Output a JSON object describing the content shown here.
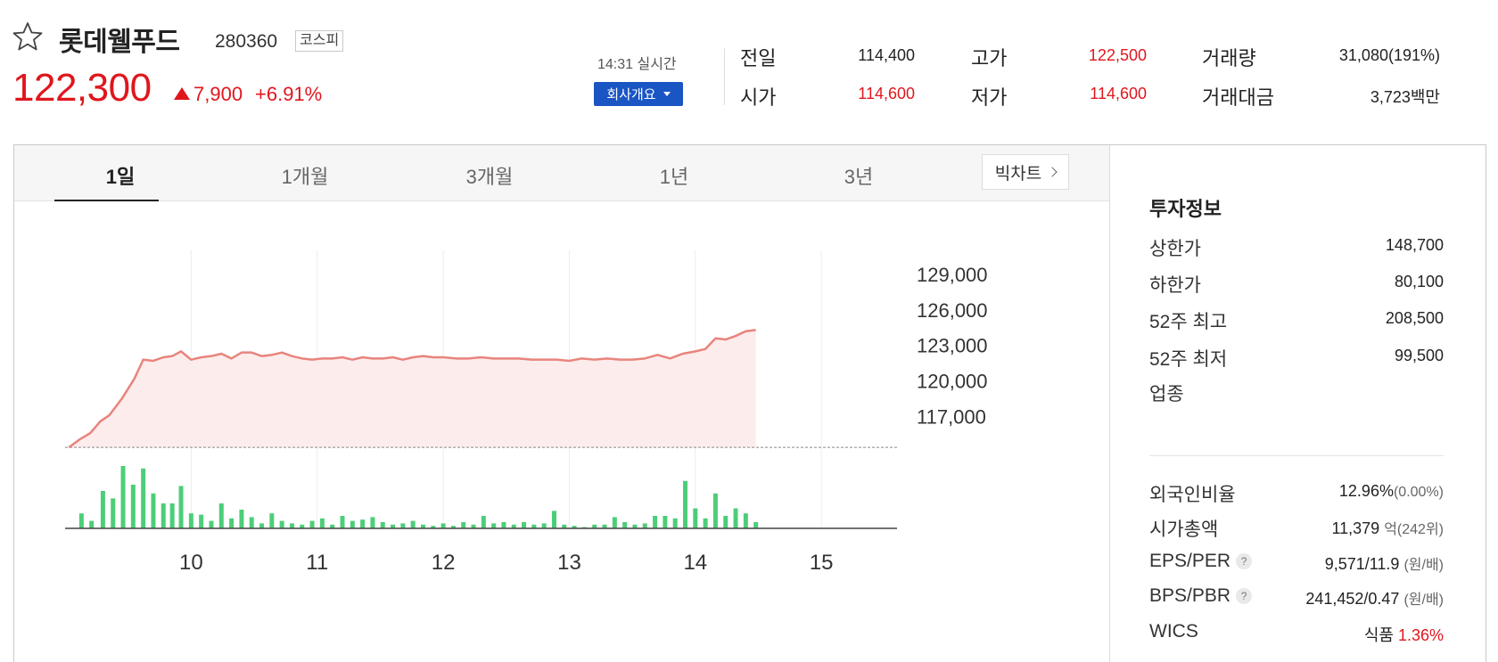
{
  "header": {
    "name": "롯데웰푸드",
    "code": "280360",
    "market": "코스피",
    "price": "122,300",
    "change": "7,900",
    "rate": "+6.91%",
    "rt_time": "14:31 실시간",
    "company_btn": "회사개요"
  },
  "stats": {
    "prev_label": "전일",
    "prev": "114,400",
    "open_label": "시가",
    "open": "114,600",
    "high_label": "고가",
    "high": "122,500",
    "low_label": "저가",
    "low": "114,600",
    "vol_label": "거래량",
    "vol": "31,080(191%)",
    "amt_label": "거래대금",
    "amt": "3,723백만"
  },
  "tabs": [
    "1일",
    "1개월",
    "3개월",
    "1년",
    "3년"
  ],
  "bigchart_label": "빅차트",
  "info": {
    "title": "투자정보",
    "upper_label": "상한가",
    "upper": "148,700",
    "lower_label": "하한가",
    "lower": "80,100",
    "w52h_label": "52주 최고",
    "w52h": "208,500",
    "w52l_label": "52주 최저",
    "w52l": "99,500",
    "sector_label": "업종",
    "foreign_label": "외국인비율",
    "foreign": "12.96%",
    "foreign_sub": "(0.00%)",
    "mcap_label": "시가총액",
    "mcap": "11,379",
    "mcap_unit": "억",
    "mcap_sub": "(242위)",
    "eps_label": "EPS/PER",
    "eps": "9,571/11.9",
    "eps_sub": "(원/배)",
    "bps_label": "BPS/PBR",
    "bps": "241,452/0.47",
    "bps_sub": "(원/배)",
    "wics_label": "WICS",
    "wics": "식품",
    "wics_rate": "1.36%"
  },
  "chart_data": {
    "type": "area",
    "y_ticks": [
      "129,000",
      "126,000",
      "123,000",
      "120,000",
      "117,000"
    ],
    "x_ticks": [
      "10",
      "11",
      "12",
      "13",
      "14",
      "15"
    ],
    "ylim": [
      112000,
      132000
    ],
    "xlim": [
      9.0,
      15.6
    ],
    "baseline": 114400,
    "colors": {
      "line": "#e8847d",
      "fill": "#fdecec",
      "volume": "#4cce78"
    },
    "series": [
      {
        "x": [
          9.03,
          9.12,
          9.2,
          9.28,
          9.35,
          9.45,
          9.55,
          9.62,
          9.7,
          9.78,
          9.85,
          9.92,
          10.0,
          10.08,
          10.16,
          10.24,
          10.32,
          10.4,
          10.48,
          10.56,
          10.64,
          10.72,
          10.8,
          10.88,
          10.96,
          11.04,
          11.12,
          11.2,
          11.28,
          11.36,
          11.44,
          11.52,
          11.6,
          11.68,
          11.76,
          11.84,
          11.92,
          12.0,
          12.1,
          12.2,
          12.3,
          12.4,
          12.5,
          12.6,
          12.7,
          12.8,
          12.9,
          13.0,
          13.1,
          13.2,
          13.3,
          13.4,
          13.5,
          13.6,
          13.7,
          13.8,
          13.9,
          14.0,
          14.08,
          14.16,
          14.24,
          14.32,
          14.4,
          14.48
        ],
        "y": [
          114400,
          115100,
          115600,
          116600,
          117100,
          118500,
          120200,
          121800,
          121700,
          122000,
          122100,
          122500,
          121800,
          122000,
          122100,
          122300,
          121900,
          122400,
          122400,
          122100,
          122200,
          122400,
          122100,
          121900,
          121800,
          121900,
          121900,
          122000,
          121800,
          122000,
          121900,
          121900,
          122000,
          121800,
          122000,
          122100,
          122000,
          122000,
          121900,
          121900,
          122000,
          121900,
          121900,
          121900,
          121800,
          121800,
          121800,
          121700,
          121900,
          121800,
          121900,
          121800,
          121800,
          121900,
          122200,
          121900,
          122300,
          122500,
          122700,
          123600,
          123500,
          123800,
          124200,
          124300
        ]
      }
    ],
    "volume": {
      "x": [
        9.13,
        9.21,
        9.3,
        9.38,
        9.46,
        9.54,
        9.62,
        9.7,
        9.78,
        9.85,
        9.92,
        10.0,
        10.08,
        10.16,
        10.24,
        10.32,
        10.4,
        10.48,
        10.56,
        10.64,
        10.72,
        10.8,
        10.88,
        10.96,
        11.04,
        11.12,
        11.2,
        11.28,
        11.36,
        11.44,
        11.52,
        11.6,
        11.68,
        11.76,
        11.84,
        11.92,
        12.0,
        12.08,
        12.16,
        12.24,
        12.32,
        12.4,
        12.48,
        12.56,
        12.64,
        12.72,
        12.8,
        12.88,
        12.96,
        13.04,
        13.12,
        13.2,
        13.28,
        13.36,
        13.44,
        13.52,
        13.6,
        13.68,
        13.76,
        13.84,
        13.92,
        14.0,
        14.08,
        14.16,
        14.24,
        14.32,
        14.4,
        14.48
      ],
      "v": [
        12,
        6,
        30,
        24,
        50,
        35,
        48,
        28,
        20,
        20,
        34,
        12,
        11,
        6,
        20,
        8,
        15,
        9,
        4,
        12,
        6,
        4,
        3,
        6,
        8,
        3,
        10,
        6,
        7,
        9,
        5,
        3,
        4,
        6,
        3,
        2,
        4,
        2,
        5,
        3,
        10,
        4,
        5,
        3,
        5,
        3,
        4,
        14,
        3,
        2,
        1,
        3,
        3,
        9,
        5,
        3,
        4,
        10,
        10,
        8,
        38,
        16,
        8,
        28,
        10,
        16,
        12,
        5
      ]
    }
  }
}
